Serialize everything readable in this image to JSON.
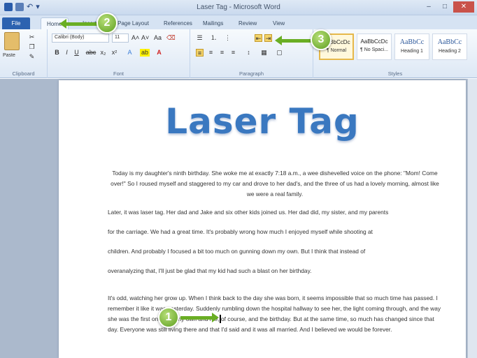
{
  "window": {
    "title": "Laser Tag - Microsoft Word",
    "controls": {
      "minimize": "–",
      "maximize": "□",
      "close": "✕"
    }
  },
  "quick_access": {
    "undo": "↶",
    "redo": "▾"
  },
  "tabs": [
    {
      "label": "File"
    },
    {
      "label": "Home"
    },
    {
      "label": "Insert"
    },
    {
      "label": "Page Layout"
    },
    {
      "label": "References"
    },
    {
      "label": "Mailings"
    },
    {
      "label": "Review"
    },
    {
      "label": "View"
    }
  ],
  "ribbon": {
    "clipboard": {
      "label": "Clipboard",
      "paste": "Paste"
    },
    "font": {
      "label": "Font",
      "font_name": "Calibri (Body)",
      "font_size": "11",
      "bold": "B",
      "italic": "I",
      "underline": "U",
      "strike": "abc",
      "subscript": "x₂",
      "superscript": "x²",
      "grow": "A˄",
      "shrink": "A˅",
      "clear": "Aa",
      "highlight": "ab",
      "color": "A"
    },
    "paragraph": {
      "label": "Paragraph",
      "bullets": "☰",
      "numbering": "⒈",
      "multilevel": "⋮",
      "decrease_indent": "⇤",
      "increase_indent": "⇥",
      "align_left": "≡",
      "center": "≡",
      "align_right": "≡",
      "justify": "≡",
      "line_spacing": "↕",
      "shading": "▦",
      "borders": "▢"
    },
    "styles": {
      "label": "Styles",
      "items": [
        {
          "sample": "AaBbCcDc",
          "name": "¶ Normal"
        },
        {
          "sample": "AaBbCcDc",
          "name": "¶ No Spaci..."
        },
        {
          "sample": "AaBbCc",
          "name": "Heading 1"
        },
        {
          "sample": "AaBbCc",
          "name": "Heading 2"
        }
      ]
    }
  },
  "document": {
    "title": "Laser Tag",
    "paragraphs": [
      "Today is my daughter's ninth birthday. She woke me at exactly 7:18 a.m., a wee dishevelled voice on the phone: \"Mom! Come over!\" So I roused myself and staggered to my car and drove to her dad's, and the three of us had a lovely morning, almost like we were a real family.",
      "Later, it was laser tag. Her dad and Jake and six other kids joined us. Her dad did, my sister, and my parents",
      "for the carriage. We had a great time. It's probably wrong how much I enjoyed myself while shooting at",
      "children. And probably I focused a bit too much on gunning down my own. But I think that instead of",
      "overanalyzing that, I'll just be glad that my kid had such a blast on her birthday.",
      "It's odd, watching her grow up. When I think back to the day she was born, it seems impossible that so much time has passed. I remember it like it was yesterday. Suddenly rumbling down the hospital hallway to see her, the light coming through, and the way she was the first one after my own and me, of course, and the birthday. But at the same time, so much has changed since that day. Everyone was still living there and that I'd said and it was all married. And I believed we would be forever."
    ]
  },
  "callouts": {
    "c1": "1",
    "c2": "2",
    "c3": "3"
  },
  "colors": {
    "title": "#3a78c0",
    "file_tab": "#2c62b0",
    "callout": "#6aae24"
  }
}
